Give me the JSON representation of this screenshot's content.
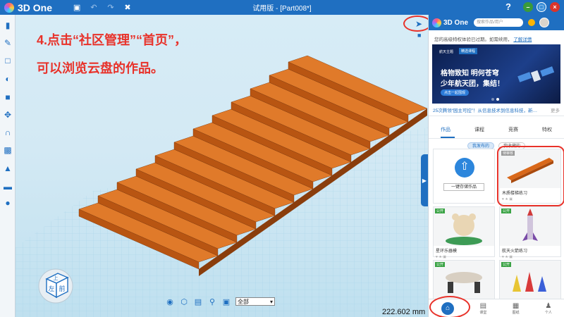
{
  "app": {
    "name": "3D One",
    "window_title": "试用版 - [Part008*]"
  },
  "annotation": {
    "line1": "4.点击“社区管理”“首页”，",
    "line2": "可以浏览云盘的作品。"
  },
  "viewport": {
    "measurement": "222.602 mm",
    "filter_value": "全部",
    "cube_labels": {
      "top": "上",
      "left": "左",
      "front": "前"
    }
  },
  "panel": {
    "logo_text": "3D One",
    "search_placeholder": "搜索作品/用户",
    "notice_text": "您的高级特权体验已过期。如需续用，",
    "notice_link": "了解详情",
    "banner": {
      "tag1": "航天主题",
      "tag2": "精选课程",
      "line1": "格物致知 明何苍穹",
      "line2": "少年航天团，集结！",
      "button": "点击一起围观"
    },
    "news": "25次腾领“园主可控”！从信息技术到信息科技，新课标引发信息...",
    "news_more": "更多",
    "tabs": [
      "作品",
      "课程",
      "竞赛",
      "特权"
    ],
    "subtabs": [
      "我发布的",
      "我收藏的"
    ],
    "upload_label": "一键存储作品",
    "cards": [
      {
        "badge": "待审核",
        "name": "木质楼梯练习",
        "meta": ""
      },
      {
        "badge": "公开",
        "name": "星环乐器模",
        "meta": ""
      },
      {
        "badge": "公开",
        "name": "航天火箭练习",
        "meta": ""
      },
      {
        "badge": "公开",
        "name": "",
        "meta": ""
      },
      {
        "badge": "公开",
        "name": "",
        "meta": ""
      }
    ],
    "bottom_nav": [
      "首页",
      "课堂",
      "图纸",
      "个人"
    ]
  },
  "colors": {
    "brand_blue": "#1f6fc1",
    "annotation_red": "#e8322a",
    "stair_orange": "#d9681a"
  }
}
